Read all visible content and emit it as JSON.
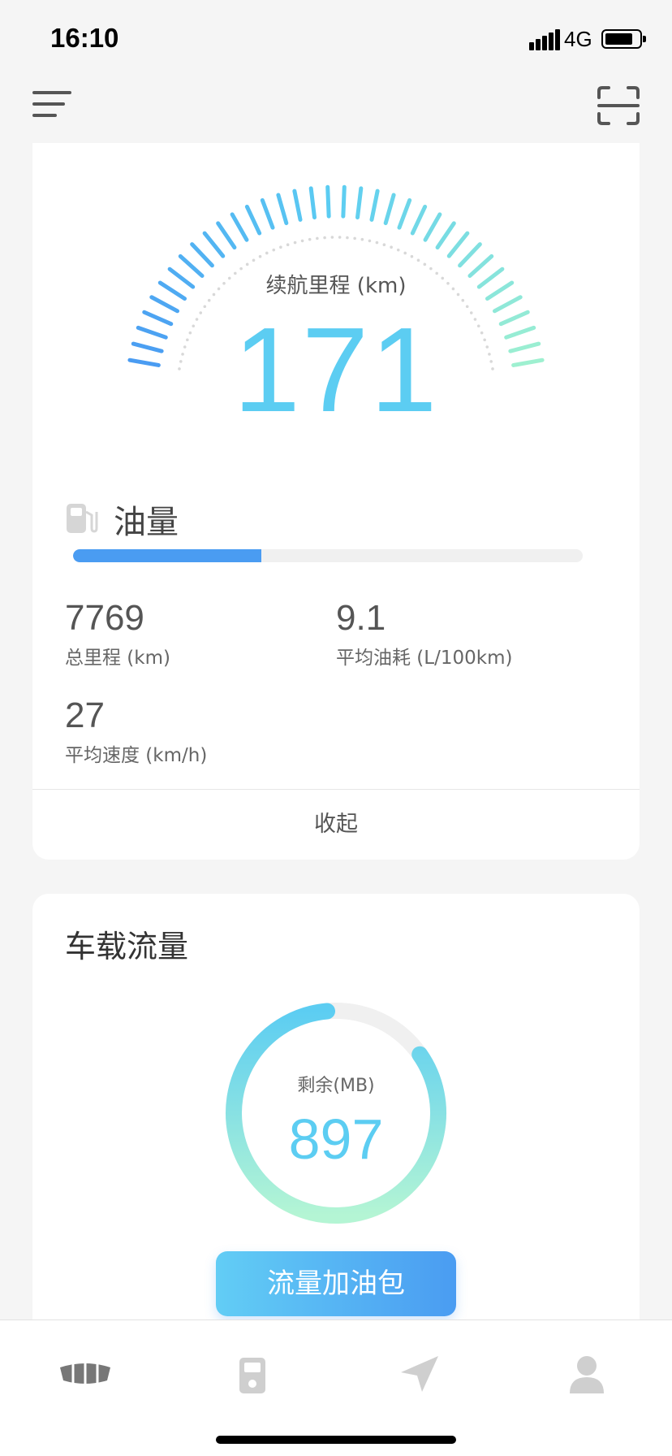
{
  "status_bar": {
    "time": "16:10",
    "network": "4G"
  },
  "gauge": {
    "label": "续航里程 (km)",
    "value": "171"
  },
  "fuel": {
    "label": "油量",
    "level": 0.37
  },
  "stats": [
    {
      "value": "7769",
      "label": "总里程 (km)"
    },
    {
      "value": "9.1",
      "label": "平均油耗 (L/100km)"
    },
    {
      "value": "27",
      "label": "平均速度 (km/h)"
    }
  ],
  "collapse_label": "收起",
  "traffic": {
    "title": "车载流量",
    "remaining_label": "剩余(MB)",
    "remaining_value": "897",
    "topup_label": "流量加油包"
  },
  "tabs": [
    {
      "icon": "car-grille-icon"
    },
    {
      "icon": "fuel-pump-icon"
    },
    {
      "icon": "navigation-arrow-icon"
    },
    {
      "icon": "user-icon"
    }
  ],
  "colors": {
    "accent_cyan": "#5ccdf2",
    "accent_blue": "#4a9cf2",
    "ring_green": "#b4f5d4"
  }
}
